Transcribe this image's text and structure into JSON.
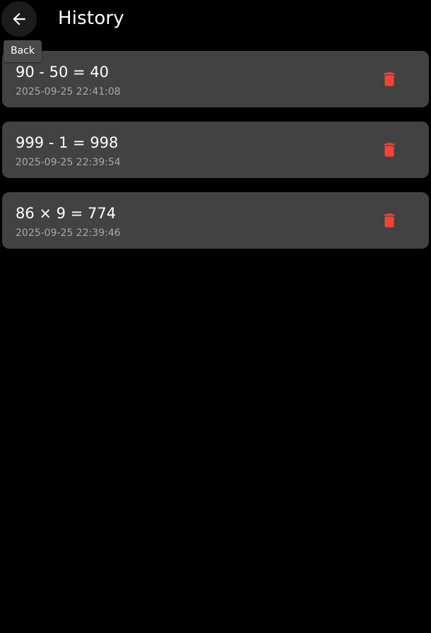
{
  "app_bar": {
    "title": "History",
    "back_icon": "arrow-left-icon"
  },
  "tooltip": {
    "text": "Back"
  },
  "history": {
    "items": [
      {
        "expression": "90 - 50 = 40",
        "timestamp": "2025-09-25 22:41:08"
      },
      {
        "expression": "999 - 1 = 998",
        "timestamp": "2025-09-25 22:39:54"
      },
      {
        "expression": "86 × 9 = 774",
        "timestamp": "2025-09-25 22:39:46"
      }
    ],
    "delete_icon": "trash-icon"
  },
  "colors": {
    "background": "#000000",
    "card": "#424242",
    "delete": "#f44336",
    "timestamp": "#a8a8a8",
    "tooltip": "#4a4a4a"
  }
}
